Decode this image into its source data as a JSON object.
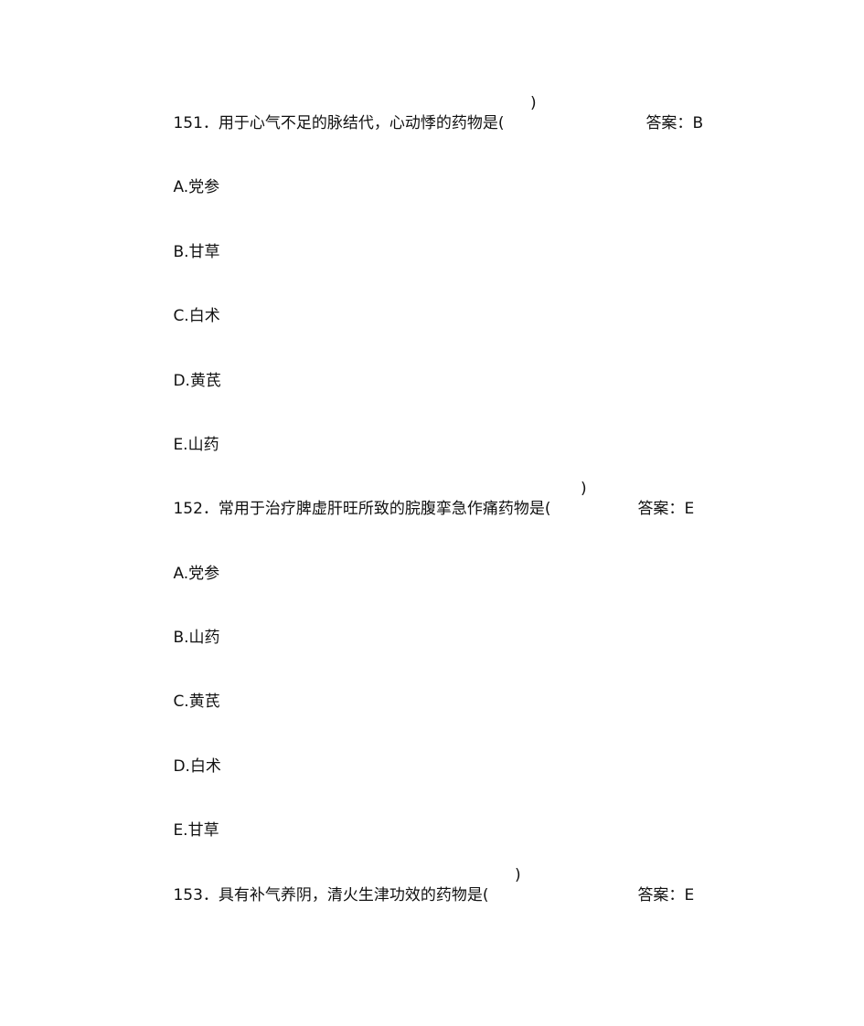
{
  "questions": [
    {
      "number": "151．",
      "stem": "用于心气不足的脉结代，心动悸的药物是(",
      "blank_close": ")",
      "answer_label": "答案：",
      "answer_value": "B",
      "options": [
        {
          "letter": "A.",
          "text": "党参"
        },
        {
          "letter": "B.",
          "text": "甘草"
        },
        {
          "letter": "C.",
          "text": "白术"
        },
        {
          "letter": "D.",
          "text": "黄芪"
        },
        {
          "letter": "E.",
          "text": "山药"
        }
      ]
    },
    {
      "number": "152．",
      "stem": "常用于治疗脾虚肝旺所致的脘腹挛急作痛药物是(",
      "blank_close": ")",
      "answer_label": "答案：",
      "answer_value": "E",
      "options": [
        {
          "letter": "A.",
          "text": "党参"
        },
        {
          "letter": "B.",
          "text": "山药"
        },
        {
          "letter": "C.",
          "text": "黄芪"
        },
        {
          "letter": "D.",
          "text": "白术"
        },
        {
          "letter": "E.",
          "text": "甘草"
        }
      ]
    },
    {
      "number": "153．",
      "stem": "具有补气养阴，清火生津功效的药物是(",
      "blank_close": ")",
      "answer_label": "答案：",
      "answer_value": "E",
      "options": []
    }
  ]
}
